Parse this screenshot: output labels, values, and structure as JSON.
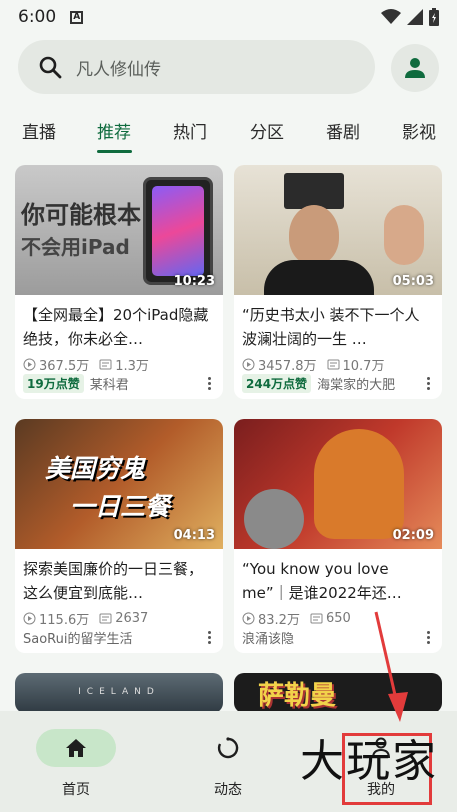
{
  "status": {
    "time": "6:00",
    "a_label": "A"
  },
  "search": {
    "placeholder": "凡人修仙传"
  },
  "tabs": [
    "直播",
    "推荐",
    "热门",
    "分区",
    "番剧",
    "影视"
  ],
  "cards": [
    {
      "thumb_text": "你可能根本",
      "thumb_text2": "不会用iPad",
      "duration": "10:23",
      "title": "【全网最全】20个iPad隐藏绝技，你未必全…",
      "views": "367.5万",
      "danmaku": "1.3万",
      "badge": "19万点赞",
      "author": "某科君"
    },
    {
      "duration": "05:03",
      "title": "“历史书太小 装不下一个人波澜壮阔的一生 …",
      "views": "3457.8万",
      "danmaku": "10.7万",
      "badge": "244万点赞",
      "author": "海棠家的大肥"
    },
    {
      "thumb_text": "美国穷鬼",
      "thumb_text2": "一日三餐",
      "duration": "04:13",
      "title": "探索美国廉价的一日三餐，这么便宜到底能…",
      "views": "115.6万",
      "danmaku": "2637",
      "author": "SaoRui的留学生活"
    },
    {
      "duration": "02:09",
      "title": "“You know you love me”｜是谁2022年还…",
      "views": "83.2万",
      "danmaku": "650",
      "author": "浪涌该隐"
    },
    {
      "thumb_text": "ICELAND"
    },
    {
      "thumb_text": "萨勒曼"
    }
  ],
  "bottom_nav": [
    {
      "label": "首页",
      "icon": "home-icon"
    },
    {
      "label": "动态",
      "icon": "refresh-icon"
    },
    {
      "label": "我的",
      "icon": "person-icon"
    }
  ],
  "watermark": "大玩家",
  "colors": {
    "accent": "#0f6b3e",
    "nav_active": "#c8e6c9",
    "annotation": "#e23b3b"
  }
}
